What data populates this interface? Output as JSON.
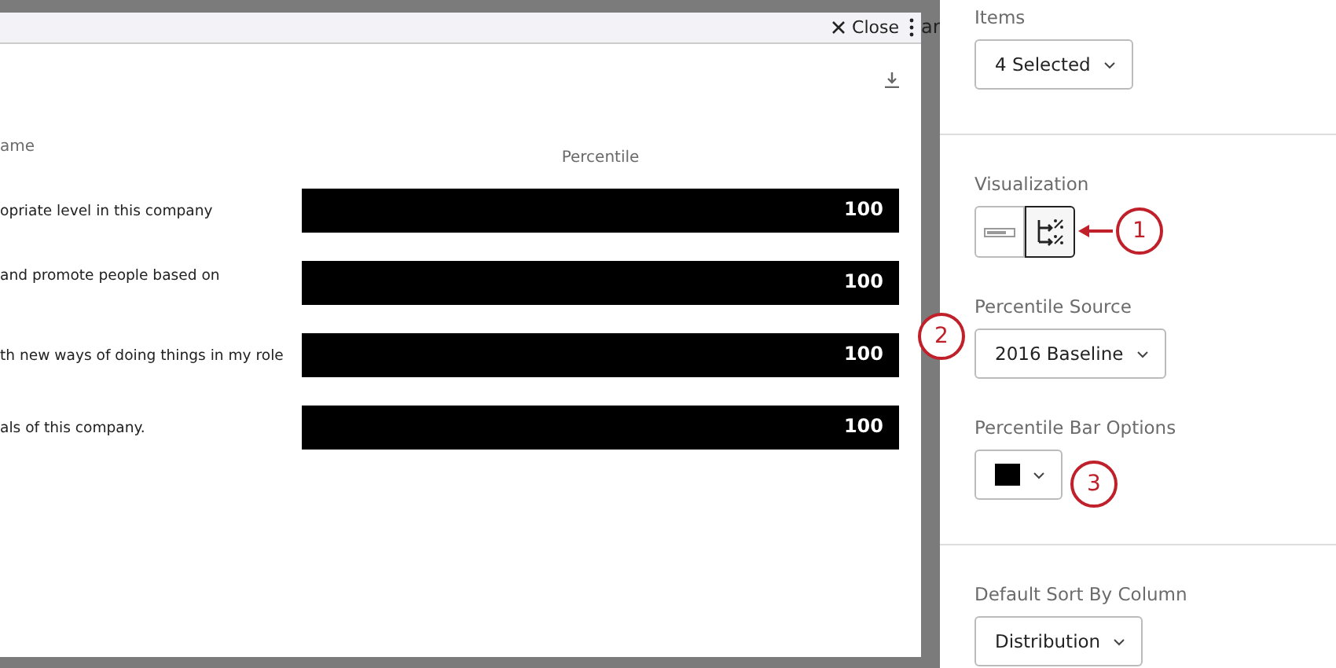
{
  "backdrop": {
    "peek_text": "ar"
  },
  "modal": {
    "close_label": "Close",
    "table": {
      "columns": [
        "ame",
        "Percentile"
      ],
      "rows": [
        {
          "label": "opriate level in this company",
          "level": 1,
          "value": "100"
        },
        {
          "label": "and promote people based on",
          "level": 1,
          "value": "100"
        },
        {
          "label": "th new ways of doing things in my role",
          "level": 1,
          "value": "100"
        },
        {
          "label": "als of this company.",
          "level": 1,
          "value": "100"
        }
      ]
    }
  },
  "panel": {
    "sections": [
      {
        "kind": "dropdown",
        "label": "Items",
        "value": "4 Selected",
        "divider_after": true
      },
      {
        "kind": "toggle",
        "label": "Visualization",
        "options": [
          {
            "kind": "bar",
            "selected": false
          },
          {
            "kind": "percent",
            "selected": true
          }
        ]
      },
      {
        "kind": "dropdown",
        "label": "Percentile Source",
        "value": "2016 Baseline"
      },
      {
        "kind": "color",
        "label": "Percentile Bar Options",
        "color": "#000000",
        "divider_after": true
      },
      {
        "kind": "dropdown",
        "label": "Default Sort By Column",
        "value": "Distribution"
      }
    ]
  },
  "annotations": [
    {
      "label": "1",
      "arrow": true
    },
    {
      "label": "2",
      "arrow": false
    },
    {
      "label": "3",
      "arrow": false
    }
  ]
}
